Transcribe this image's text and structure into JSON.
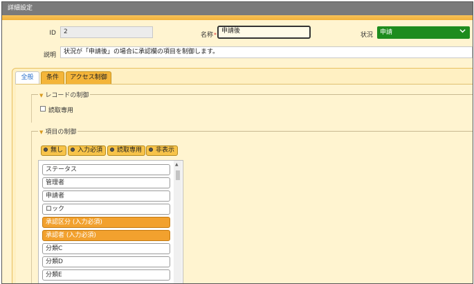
{
  "window": {
    "title": "詳細設定"
  },
  "form": {
    "id_label": "ID",
    "id_value": "2",
    "name_label": "名称",
    "name_required_mark": "*",
    "name_value": "申請後",
    "status_label": "状況",
    "status_value": "申請",
    "description_label": "説明",
    "description_value": "状況が「申請後」の場合に承認欄の項目を制御します。"
  },
  "tabs": [
    {
      "label": "全般",
      "active": true
    },
    {
      "label": "条件",
      "active": false
    },
    {
      "label": "アクセス制御",
      "active": false
    }
  ],
  "record_control": {
    "legend": "レコードの制御",
    "readonly_label": "読取専用",
    "readonly_checked": false
  },
  "item_control": {
    "legend": "項目の制御",
    "buttons": [
      "無し",
      "入力必須",
      "読取専用",
      "非表示"
    ],
    "items": [
      {
        "label": "ステータス",
        "required": false
      },
      {
        "label": "管理者",
        "required": false
      },
      {
        "label": "申請者",
        "required": false
      },
      {
        "label": "ロック",
        "required": false
      },
      {
        "label": "承認区分 (入力必須)",
        "required": true
      },
      {
        "label": "承認者 (入力必須)",
        "required": true
      },
      {
        "label": "分類C",
        "required": false
      },
      {
        "label": "分類D",
        "required": false
      },
      {
        "label": "分類E",
        "required": false
      }
    ]
  },
  "colors": {
    "status_green": "#1e8c1e",
    "accent_orange": "#f2a12e",
    "tab_orange": "#f4b53a",
    "panel_bg": "#fff4d0"
  }
}
